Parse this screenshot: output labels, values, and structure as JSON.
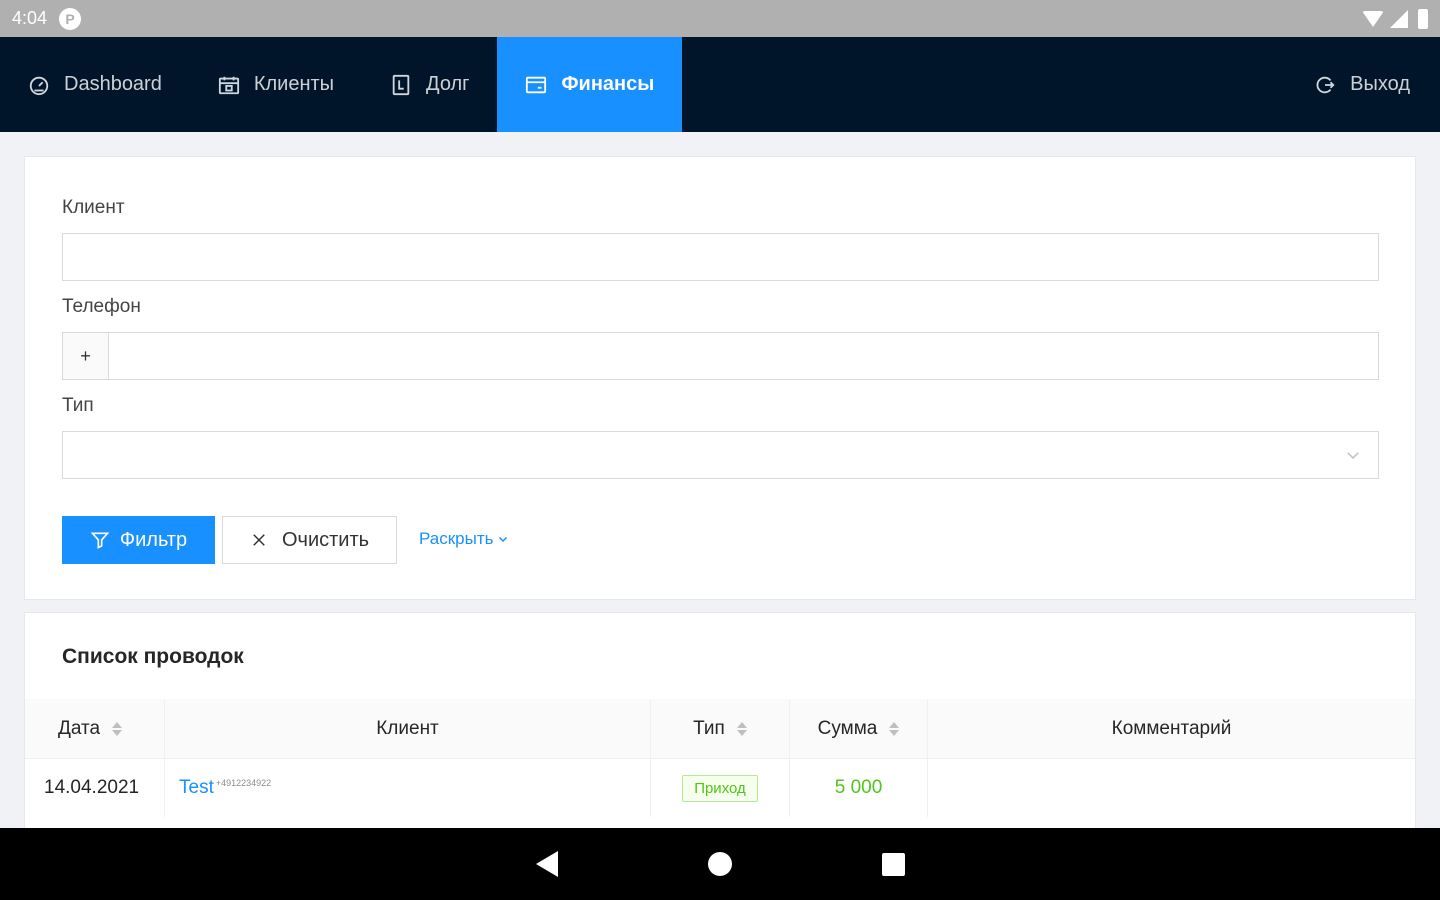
{
  "status_bar": {
    "time": "4:04",
    "app_icon": "P"
  },
  "nav": {
    "items": [
      {
        "label": "Dashboard",
        "icon": "dashboard-icon"
      },
      {
        "label": "Клиенты",
        "icon": "calendar-icon"
      },
      {
        "label": "Долг",
        "icon": "document-icon"
      },
      {
        "label": "Финансы",
        "icon": "card-icon",
        "active": true
      }
    ],
    "logout_label": "Выход"
  },
  "filter": {
    "client_label": "Клиент",
    "client_value": "",
    "phone_label": "Телефон",
    "phone_prefix": "+",
    "phone_value": "",
    "type_label": "Тип",
    "type_value": "",
    "filter_button": "Фильтр",
    "clear_button": "Очистить",
    "expand_link": "Раскрыть"
  },
  "table": {
    "title": "Список проводок",
    "columns": [
      "Дата",
      "Клиент",
      "Тип",
      "Сумма",
      "Комментарий"
    ],
    "rows": [
      {
        "date": "14.04.2021",
        "client": "Test",
        "phone": "+4912234922",
        "type": "Приход",
        "amount": "5 000",
        "comment": ""
      }
    ]
  },
  "colors": {
    "nav_bg": "#001529",
    "primary": "#1890ff",
    "success": "#52c41a"
  }
}
